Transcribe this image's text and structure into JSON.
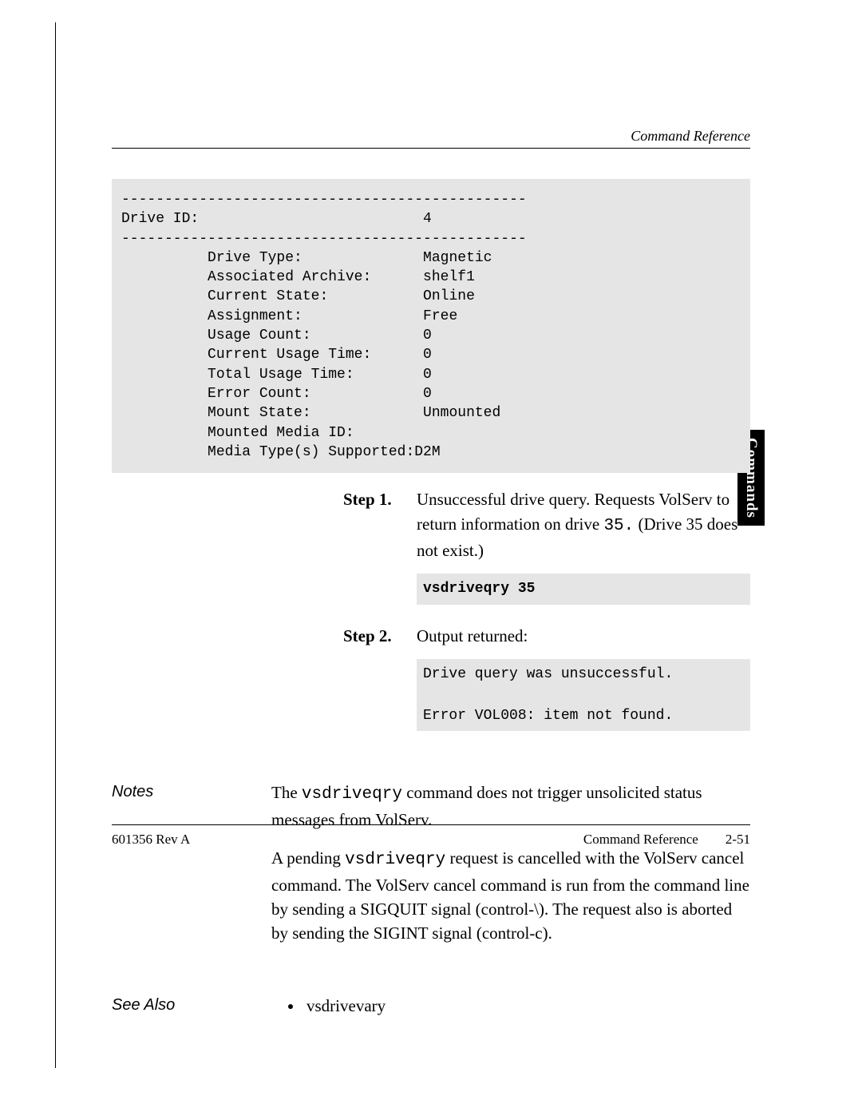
{
  "running_head": "Command Reference",
  "side_tab": "Commands",
  "code_block": "-----------------------------------------------\nDrive ID:                          4\n-----------------------------------------------\n          Drive Type:              Magnetic\n          Associated Archive:      shelf1\n          Current State:           Online\n          Assignment:              Free\n          Usage Count:             0\n          Current Usage Time:      0\n          Total Usage Time:        0\n          Error Count:             0\n          Mount State:             Unmounted\n          Mounted Media ID:\n          Media Type(s) Supported:D2M",
  "steps": {
    "s1": {
      "label": "Step 1.",
      "text_pre": "Unsuccessful drive query. Requests VolServ to return information on drive ",
      "code": "35.",
      "text_post": " (Drive 35 does not exist.)",
      "box": "vsdriveqry 35"
    },
    "s2": {
      "label": "Step 2.",
      "text": "Output returned:",
      "box": "Drive query was unsuccessful.\n\nError VOL008: item not found."
    }
  },
  "notes": {
    "label": "Notes",
    "p1_pre": "The ",
    "p1_code": "vsdriveqry",
    "p1_post": " command does not trigger unsolicited status messages from VolServ.",
    "p2_pre": "A pending ",
    "p2_code": "vsdriveqry",
    "p2_post": " request is cancelled with the VolServ cancel command. The VolServ cancel command is run from the command line by sending a SIGQUIT signal (control-\\). The request also is aborted by sending the SIGINT signal (control-c)."
  },
  "see_also": {
    "label": "See Also",
    "items": [
      "vsdrivevary"
    ]
  },
  "footer": {
    "left": "601356 Rev A",
    "center": "Command Reference",
    "right": "2-51"
  }
}
